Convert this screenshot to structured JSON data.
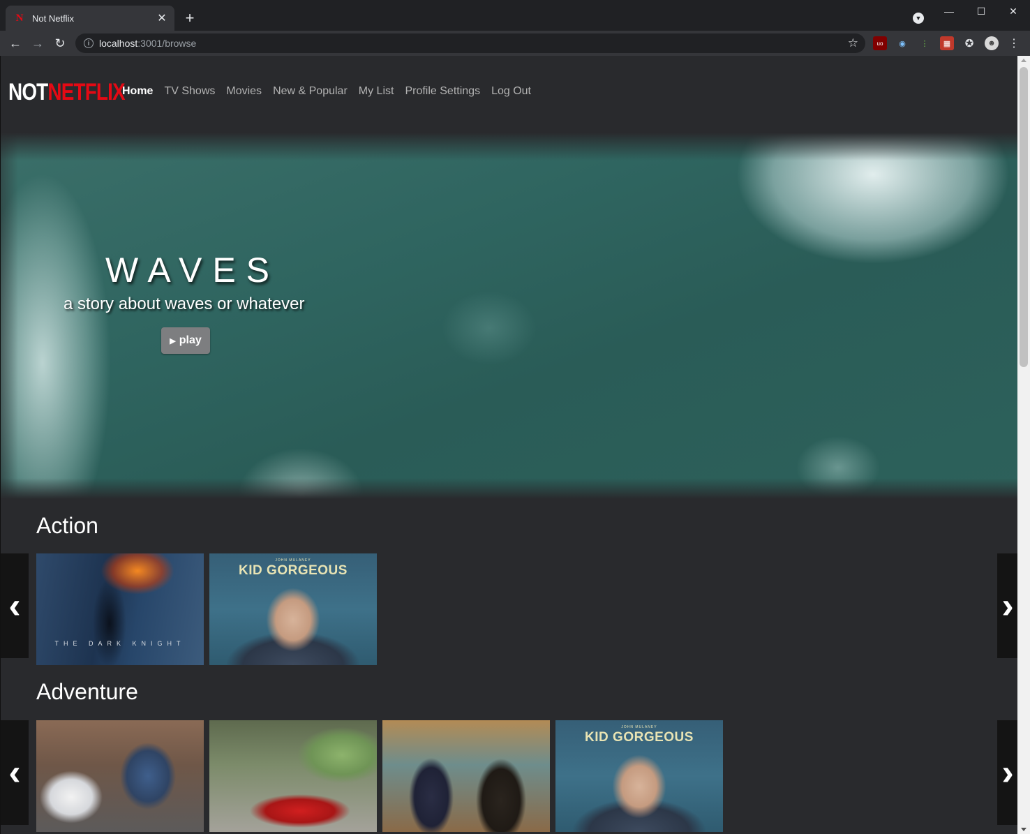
{
  "browser": {
    "tab_title": "Not Netflix",
    "url_host": "localhost",
    "url_path": ":3001/browse",
    "tab_close": "✕",
    "new_tab": "+",
    "favicon_letter": "N"
  },
  "site": {
    "logo_not": "NOT",
    "logo_netflix": "NETFLIX",
    "nav": [
      "Home",
      "TV Shows",
      "Movies",
      "New & Popular",
      "My List",
      "Profile Settings",
      "Log Out"
    ],
    "active_nav": "Home"
  },
  "hero": {
    "title": "WAVES",
    "subtitle": "a story about waves or whatever",
    "play_label": "play",
    "play_icon": "play-triangle"
  },
  "rows": [
    {
      "title": "Action",
      "cards": [
        {
          "poster": "the-dark-knight",
          "poster_text": "THE DARK KNIGHT"
        },
        {
          "poster": "kid-gorgeous",
          "poster_small": "JOHN MULANEY",
          "poster_text": "KID GORGEOUS"
        }
      ]
    },
    {
      "title": "Adventure",
      "cards": [
        {
          "poster": "police-scene"
        },
        {
          "poster": "red-car"
        },
        {
          "poster": "two-people"
        },
        {
          "poster": "kid-gorgeous",
          "poster_small": "JOHN MULANEY",
          "poster_text": "KID GORGEOUS"
        }
      ]
    }
  ],
  "colors": {
    "brand_red": "#e50914",
    "page_bg": "#292a2d"
  }
}
